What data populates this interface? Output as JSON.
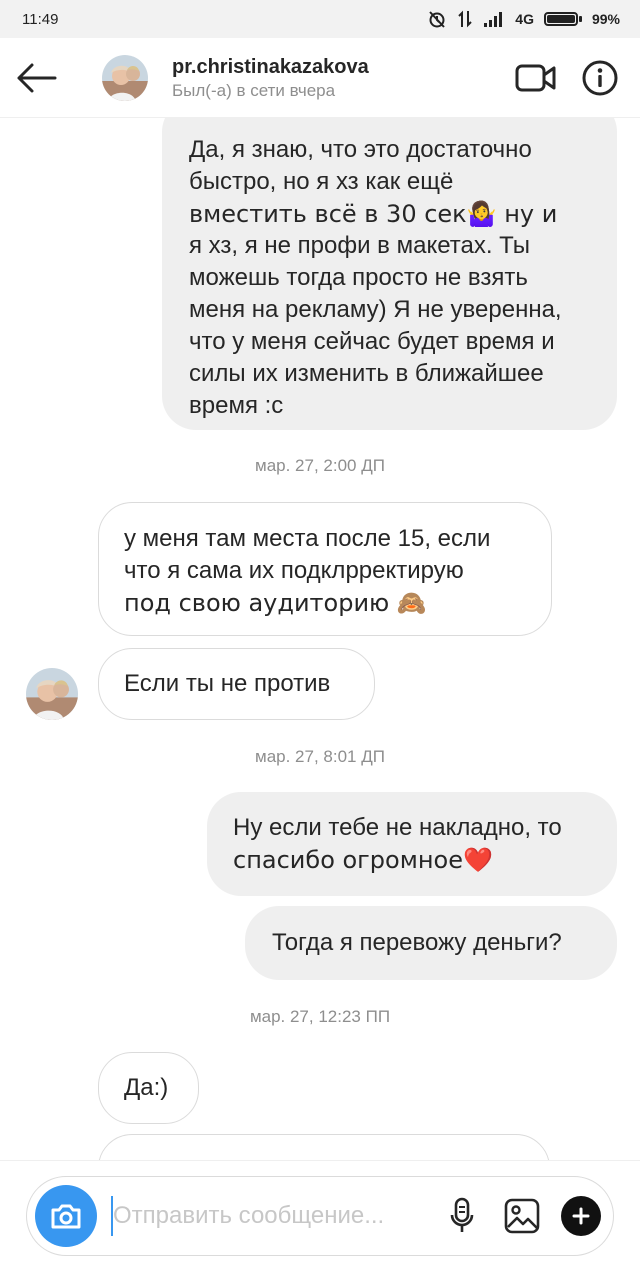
{
  "status_bar": {
    "time": "11:49",
    "network": "4G",
    "battery": "99%",
    "battery_level": 0.99
  },
  "header": {
    "username": "pr.christinakazakova",
    "presence": "Был(-а) в сети вчера",
    "icons": [
      "back-arrow-icon",
      "video-call-icon",
      "info-icon"
    ]
  },
  "messages": [
    {
      "direction": "outgoing",
      "lines": [
        "Да, я знаю, что это достаточно",
        "быстро, но я хз как ещё",
        "вместить всё в 30 сек🤷‍♀️ ну и",
        "я хз, я не профи в макетах. Ты",
        "можешь тогда просто не взять",
        "меня на рекламу) Я не уверенна,",
        "что у меня сейчас будет время и",
        "силы их изменить в ближайшее",
        "время :с"
      ]
    },
    {
      "timestamp": "мар. 27, 2:00 ДП"
    },
    {
      "direction": "incoming",
      "lines": [
        "у меня там места после 15, если",
        "что я сама их подклрректирую",
        "под свою аудиторию 🙈"
      ]
    },
    {
      "direction": "incoming",
      "lines": [
        "Если ты не против"
      ]
    },
    {
      "timestamp": "мар. 27, 8:01 ДП"
    },
    {
      "direction": "outgoing",
      "lines": [
        "Ну если тебе не накладно, то",
        "спасибо огромное❤️"
      ]
    },
    {
      "direction": "outgoing",
      "lines": [
        "Тогда я перевожу деньги?"
      ]
    },
    {
      "timestamp": "мар. 27, 12:23 ПП"
    },
    {
      "direction": "incoming",
      "lines": [
        "Да:)"
      ]
    }
  ],
  "composer": {
    "placeholder": "Отправить сообщение...",
    "icons": [
      "camera-icon",
      "microphone-icon",
      "gallery-icon",
      "plus-icon"
    ]
  },
  "colors": {
    "accent": "#3897f0",
    "outgoing_bubble": "#efefef",
    "incoming_border": "#dbdbdb",
    "secondary_text": "#8e8e8e"
  }
}
